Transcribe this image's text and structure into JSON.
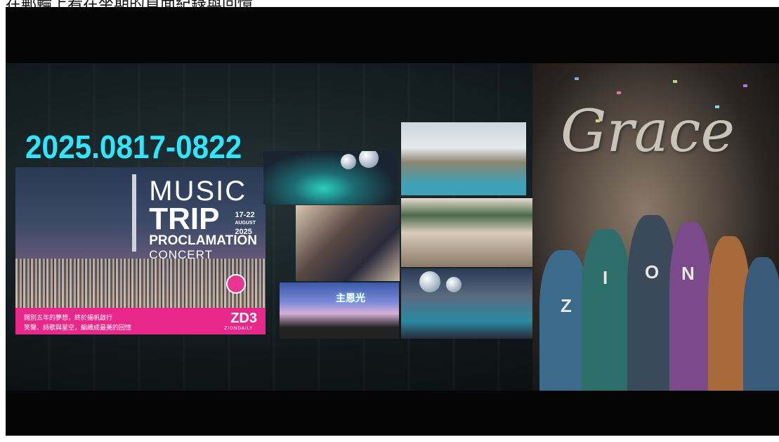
{
  "caption": "在郵輪上看在坐期的頁面紀錄與回憶",
  "banner": {
    "date": "2025.0817-0822",
    "poster": {
      "music": "MUSIC",
      "trip": "TRIP",
      "dates_small": [
        "17-22",
        "AUGUST",
        "2025"
      ],
      "proclamation": "PROCLAMATION",
      "concert": "CONCERT",
      "line1": "闊別五年的夢想，終於揚帆啟行",
      "line2": "笑聲、詩歌與星空，編織成最美的回憶",
      "logo": "ZD3",
      "logo_small": "ZIONDAILY"
    },
    "photo_title": "主恩光",
    "grace": "Grace",
    "letters": [
      "Z",
      "I",
      "O",
      "N"
    ],
    "colors": {
      "date": "#2ee6ff",
      "pink": "#e8278a"
    }
  }
}
